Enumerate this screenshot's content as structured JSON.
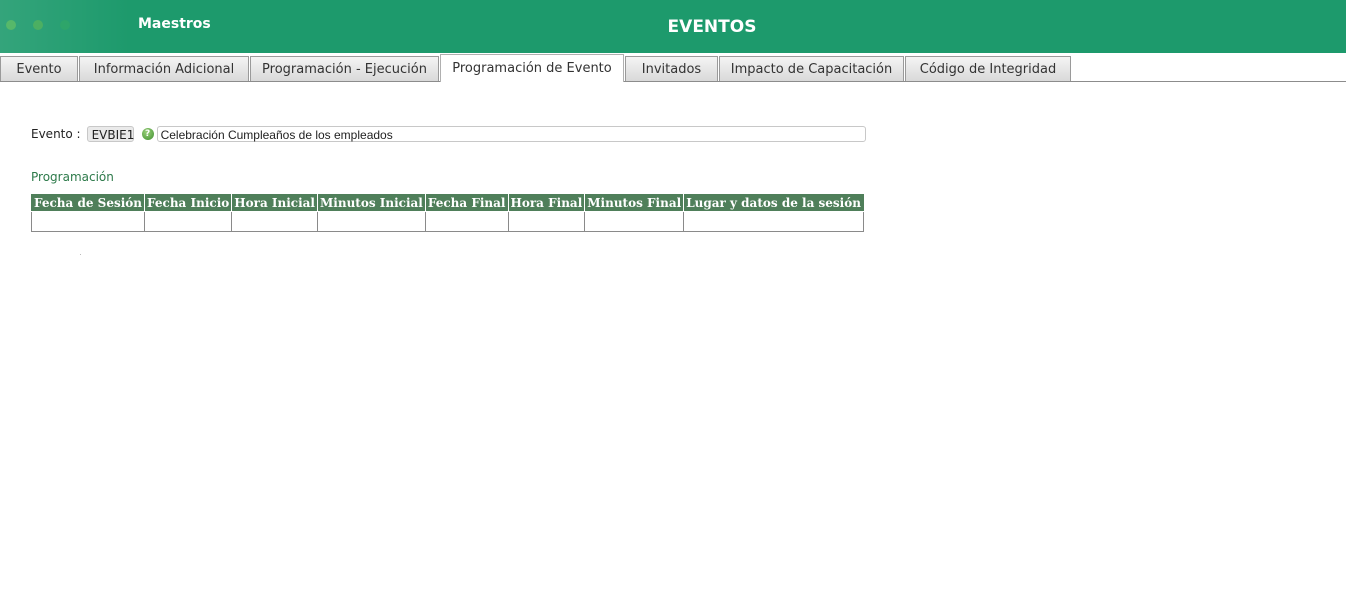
{
  "header": {
    "section": "Maestros",
    "title": "EVENTOS"
  },
  "tabs": [
    {
      "label": "Evento",
      "active": false
    },
    {
      "label": "Información Adicional",
      "active": false
    },
    {
      "label": "Programación - Ejecución",
      "active": false
    },
    {
      "label": "Programación de Evento",
      "active": true
    },
    {
      "label": "Invitados",
      "active": false
    },
    {
      "label": "Impacto de Capacitación",
      "active": false
    },
    {
      "label": "Código de Integridad",
      "active": false
    }
  ],
  "evento": {
    "label": "Evento :",
    "code": "EVBIE1",
    "help_icon": "help-question-icon",
    "description": "Celebración Cumpleaños de los empleados"
  },
  "programacion": {
    "title": "Programación",
    "columns": [
      "Fecha de Sesión",
      "Fecha Inicio",
      "Hora Inicial",
      "Minutos Inicial",
      "Fecha Final",
      "Hora Final",
      "Minutos Final",
      "Lugar y datos de la sesión"
    ],
    "rows": [
      [
        "",
        "",
        "",
        "",
        "",
        "",
        "",
        ""
      ]
    ]
  },
  "colors": {
    "header_bg": "#1d9a6c",
    "table_header_bg": "#4f7f5a",
    "section_title": "#2d7a4a"
  }
}
